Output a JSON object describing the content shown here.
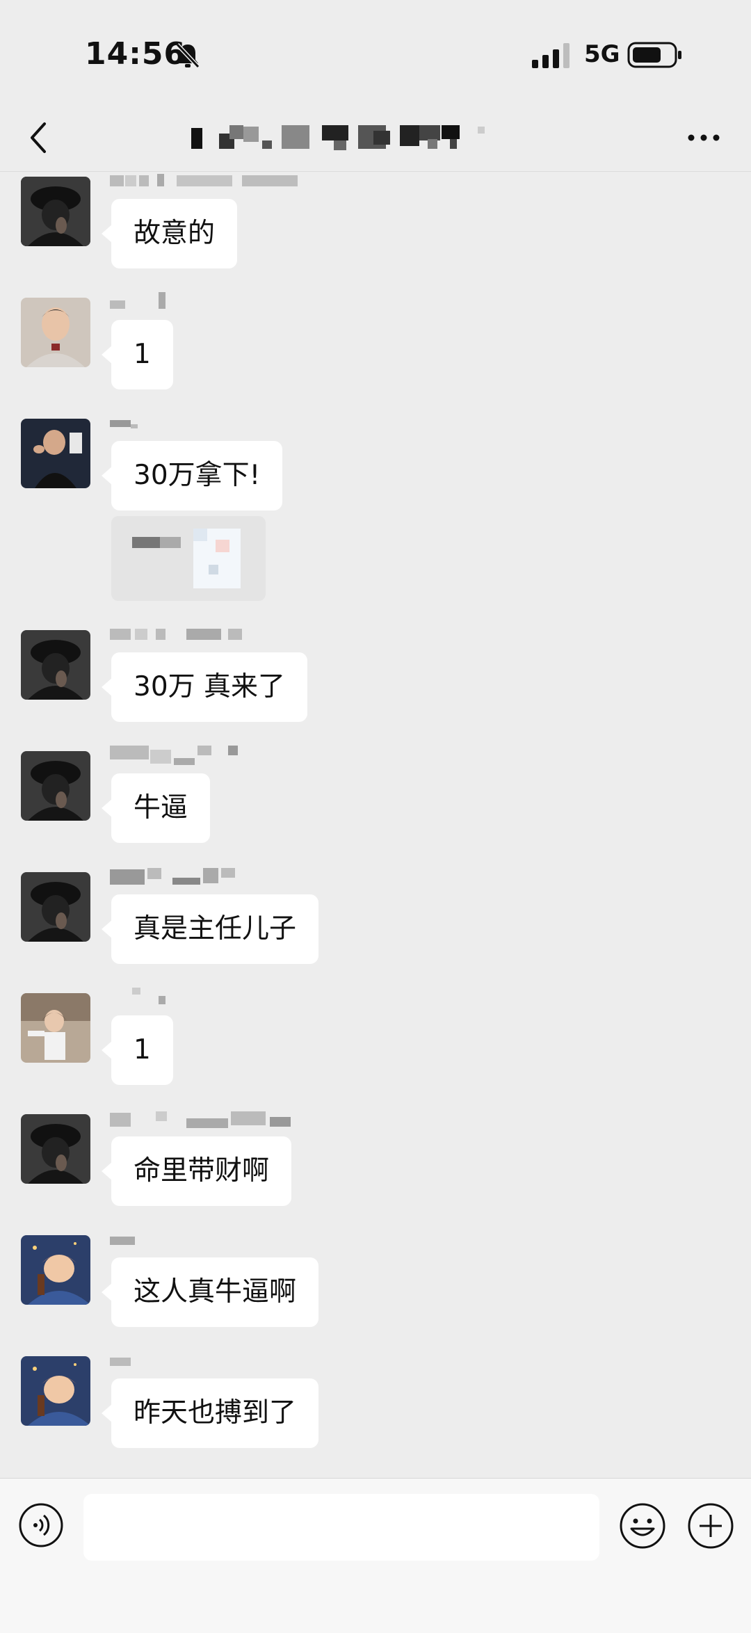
{
  "status_bar": {
    "time": "14:56",
    "network": "5G"
  },
  "messages": [
    {
      "text": "故意的"
    },
    {
      "text": "1"
    },
    {
      "text": "30万拿下!"
    },
    {
      "text": "30万 真来了"
    },
    {
      "text": "牛逼"
    },
    {
      "text": "真是主任儿子"
    },
    {
      "text": "1"
    },
    {
      "text": "命里带财啊"
    },
    {
      "text": "这人真牛逼啊"
    },
    {
      "text": "昨天也搏到了"
    }
  ],
  "input": {
    "value": "",
    "placeholder": ""
  },
  "icons": {
    "back": "chevron-left-icon",
    "more": "more-dots-icon",
    "voice": "voice-icon",
    "emoji": "emoji-icon",
    "plus": "plus-icon",
    "mute": "bell-off-icon"
  },
  "colors": {
    "background": "#ededed",
    "bubble": "#ffffff",
    "input_bar": "#f7f7f7"
  }
}
